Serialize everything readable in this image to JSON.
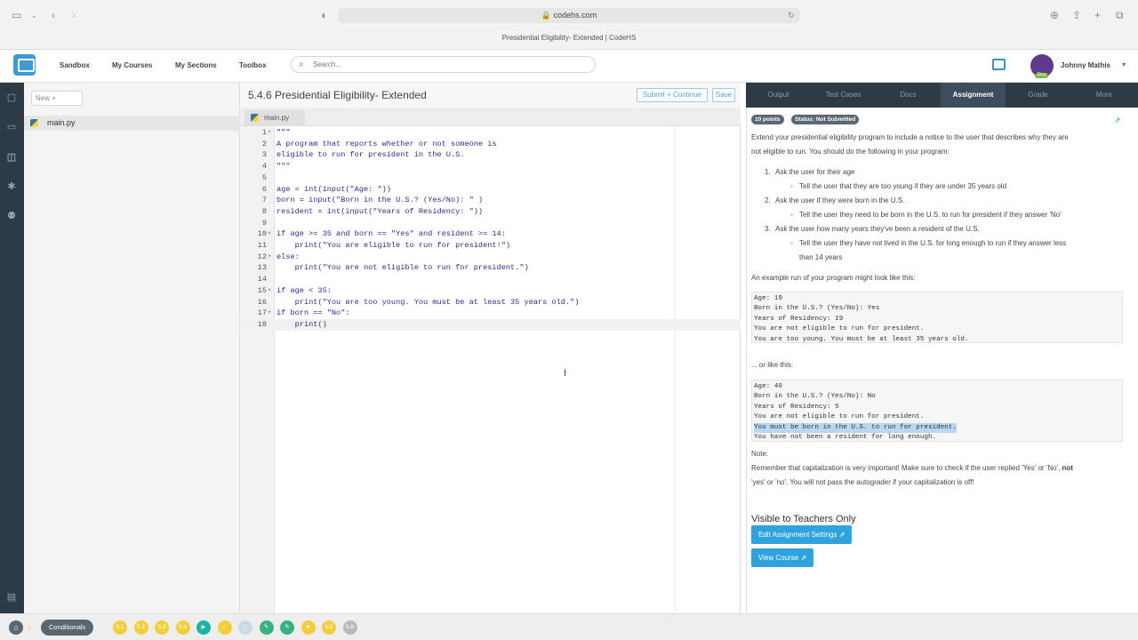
{
  "browser": {
    "url": "codehs.com",
    "tab_title": "Presidential Eligibility- Extended | CodeHS"
  },
  "header": {
    "nav": [
      "Sandbox",
      "My Courses",
      "My Sections",
      "Toolbox"
    ],
    "search_placeholder": "Search...",
    "user_name": "Johnny Mathis",
    "pro_badge": "Pro"
  },
  "files": {
    "new_label": "New +",
    "items": [
      "main.py"
    ]
  },
  "editor": {
    "title": "5.4.6 Presidential Eligibility- Extended",
    "submit_label": "Submit + Continue",
    "save_label": "Save",
    "tab_name": "main.py",
    "lines": [
      "\"\"\"",
      "A program that reports whether or not someone is",
      "eligible to run for president in the U.S.",
      "\"\"\"",
      "",
      "age = int(input(\"Age: \"))",
      "born = input(\"Born in the U.S.? (Yes/No): \" )",
      "resident = int(input(\"Years of Residency: \"))",
      "",
      "if age >= 35 and born == \"Yes\" and resident >= 14:",
      "    print(\"You are eligible to run for president!\")",
      "else:",
      "    print(\"You are not eligible to run for president.\")",
      "",
      "if age < 35:",
      "    print(\"You are too young. You must be at least 35 years old.\")",
      "if born == \"No\":",
      "    print()"
    ]
  },
  "right_tabs": [
    "Output",
    "Test Cases",
    "Docs",
    "Assignment",
    "Grade",
    "More"
  ],
  "assignment": {
    "points_badge": "10 points",
    "status_badge": "Status: Not Submitted",
    "intro_1": "Extend your presidential eligibility program to include a notice to the user that describes why they are",
    "intro_2": "not eligible to run. You should do the following in your program:",
    "steps": [
      {
        "num": "1.",
        "text": "Ask the user for their age",
        "sub": [
          "Tell the user that they are too young if they are under 35 years old"
        ]
      },
      {
        "num": "2.",
        "text": "Ask the user if they were born in the U.S.",
        "sub": [
          "Tell the user they need to be born in the U.S. to run for president if they answer 'No'"
        ]
      },
      {
        "num": "3.",
        "text": "Ask the user how many years they've been a resident of the U.S.",
        "sub": [
          "Tell the user they have not lived in the U.S. for long enough to run if they answer less",
          "than 14 years"
        ]
      }
    ],
    "example_intro": "An example run of your program might look like this:",
    "example_1": [
      "Age: 19",
      "Born in the U.S.? (Yes/No): Yes",
      "Years of Residency: 19",
      "You are not eligible to run for president.",
      "You are too young. You must be at least 35 years old."
    ],
    "or_like_this": "... or like this:",
    "example_2": [
      "Age: 40",
      "Born in the U.S.? (Yes/No): No",
      "Years of Residency: 5",
      "You are not eligible to run for president.",
      "You must be born in the U.S. to run for president.",
      "You have not been a resident for long enough."
    ],
    "note_label": "Note:",
    "note_1a": "Remember that capitalization is very important! Make sure to check if the user replied 'Yes' or 'No', ",
    "note_1b": "not",
    "note_2": "'yes' or 'no'. You will not pass the autograder if your capitalization is off!",
    "teachers_title": "Visible to Teachers Only",
    "edit_settings_label": "Edit Assignment Settings",
    "view_course_label": "View Course"
  },
  "bottom": {
    "unit_label": "Conditionals",
    "chips": [
      "5.1",
      "5.2",
      "5.3",
      "5.4",
      "",
      "",
      "",
      "",
      "",
      "",
      "5.5",
      "5.6"
    ]
  },
  "colors": {
    "rail": "#2d3b47",
    "accent_blue": "#2ea3dd",
    "chip_yellow": "#f2cf3a",
    "chip_green": "#36b37e",
    "chip_teal": "#1bb3a3"
  }
}
